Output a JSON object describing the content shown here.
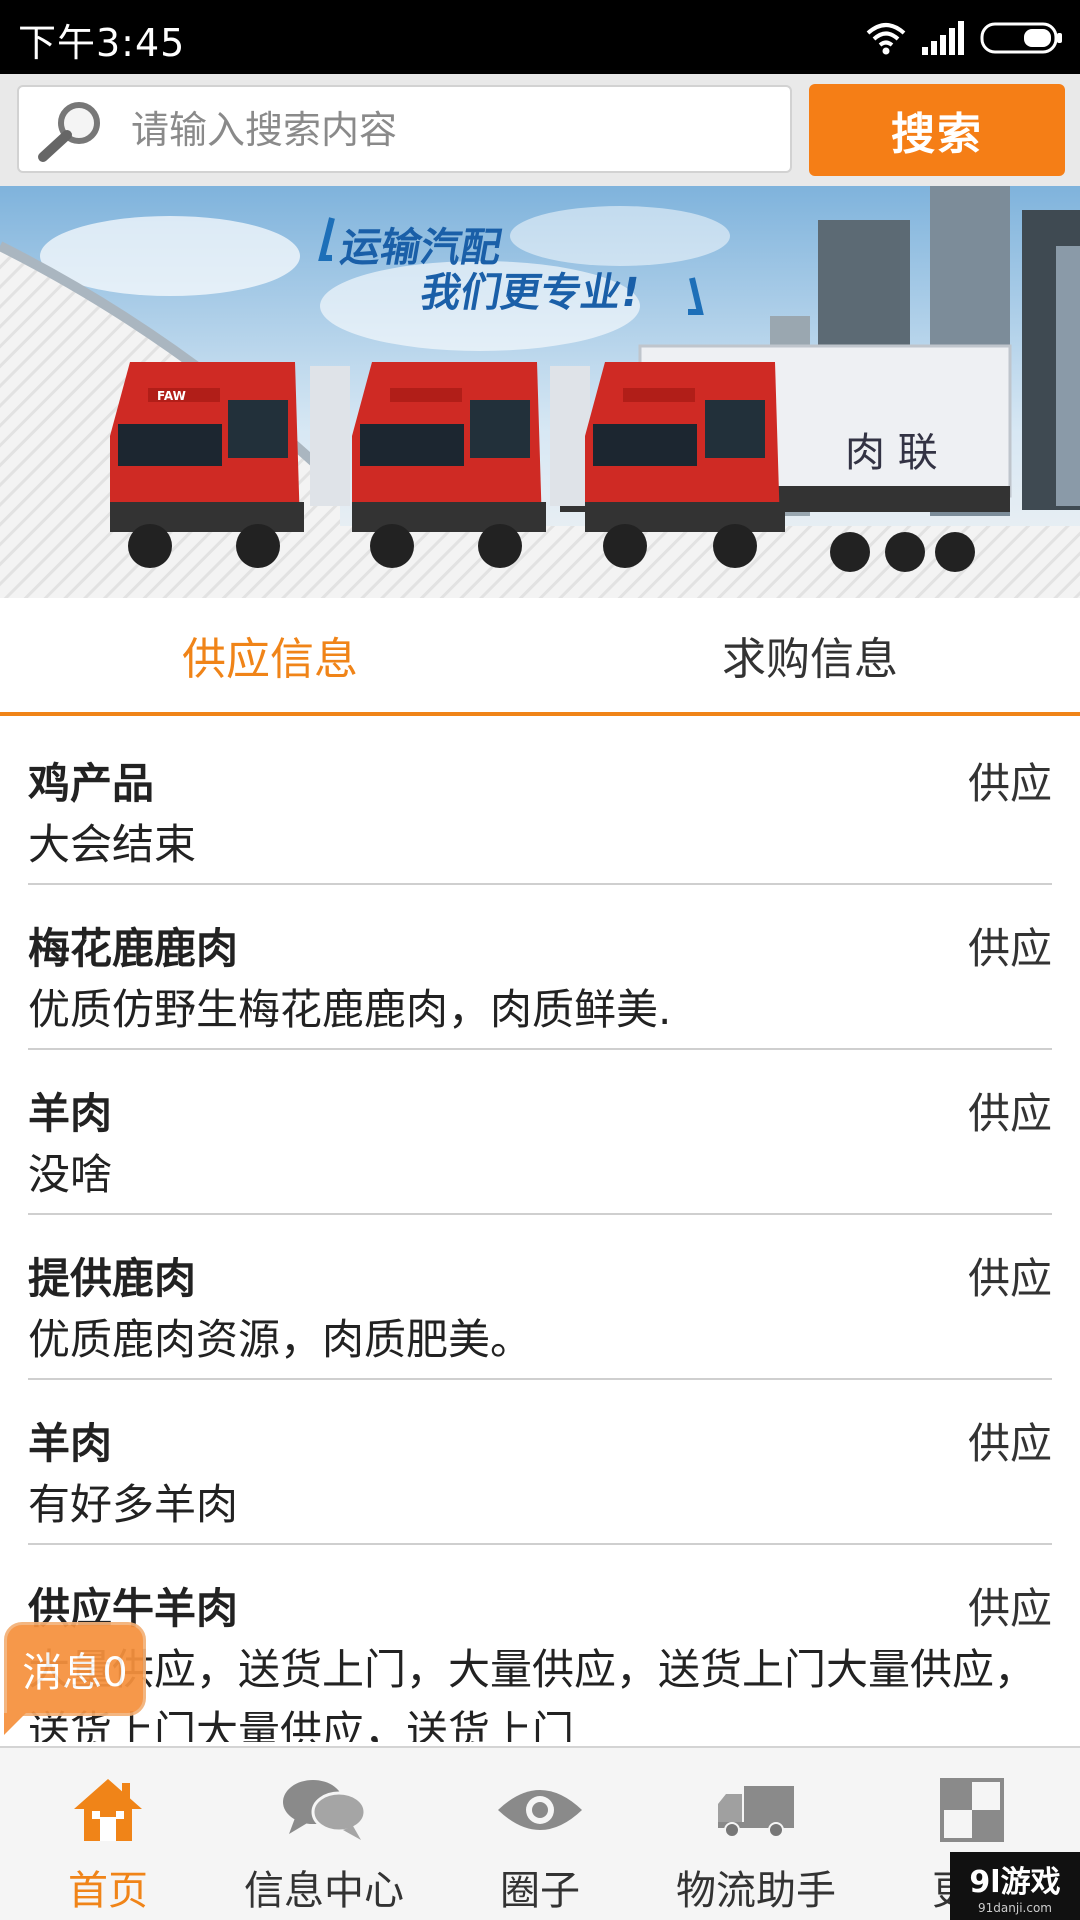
{
  "status_bar": {
    "time": "下午3:45"
  },
  "search": {
    "placeholder": "请输入搜索内容",
    "button_label": "搜索"
  },
  "banner": {
    "headline_line1": "运输汽配",
    "headline_line2": "我们更专业!",
    "truck_text": "肉 联",
    "cab_badge": "FAW"
  },
  "tabs": [
    {
      "label": "供应信息",
      "active": true
    },
    {
      "label": "求购信息",
      "active": false
    }
  ],
  "list": [
    {
      "title": "鸡产品",
      "tag": "供应",
      "desc": "大会结束"
    },
    {
      "title": "梅花鹿鹿肉",
      "tag": "供应",
      "desc": "优质仿野生梅花鹿鹿肉，肉质鲜美."
    },
    {
      "title": "羊肉",
      "tag": "供应",
      "desc": "没啥"
    },
    {
      "title": "提供鹿肉",
      "tag": "供应",
      "desc": "优质鹿肉资源，肉质肥美。"
    },
    {
      "title": "羊肉",
      "tag": "供应",
      "desc": "有好多羊肉"
    },
    {
      "title": "供应牛羊肉",
      "tag": "供应",
      "desc": "大量供应，送货上门，大量供应，送货上门大量供应，送货上门大量供应，送货上门"
    }
  ],
  "message_badge": "消息0",
  "bottom_nav": [
    {
      "label": "首页",
      "icon": "home-icon",
      "active": true
    },
    {
      "label": "信息中心",
      "icon": "chat-bubbles-icon",
      "active": false
    },
    {
      "label": "圈子",
      "icon": "eye-icon",
      "active": false
    },
    {
      "label": "物流助手",
      "icon": "truck-icon",
      "active": false
    },
    {
      "label": "更多",
      "icon": "grid-icon",
      "active": false
    }
  ],
  "watermark": {
    "brand": "9l游戏",
    "url": "91danji.com"
  },
  "colors": {
    "accent": "#f08418",
    "search_button": "#f57e16",
    "status_bar": "#000000"
  }
}
